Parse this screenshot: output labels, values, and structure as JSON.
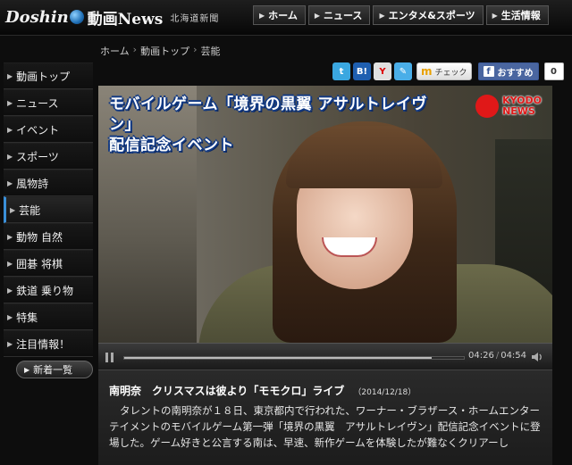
{
  "header": {
    "logo_main": "Doshin",
    "logo_news": "動画News",
    "logo_paper": "北海道新聞",
    "nav": [
      {
        "label": "ホーム"
      },
      {
        "label": "ニュース"
      },
      {
        "label": "エンタメ&スポーツ"
      },
      {
        "label": "生活情報"
      }
    ]
  },
  "breadcrumb": [
    "ホーム",
    "動画トップ",
    "芸能"
  ],
  "sidebar": {
    "items": [
      {
        "label": "動画トップ"
      },
      {
        "label": "ニュース"
      },
      {
        "label": "イベント"
      },
      {
        "label": "スポーツ"
      },
      {
        "label": "風物詩"
      },
      {
        "label": "芸能"
      },
      {
        "label": "動物 自然"
      },
      {
        "label": "囲碁 将棋"
      },
      {
        "label": "鉄道 乗り物"
      },
      {
        "label": "特集"
      },
      {
        "label": "注目情報！"
      }
    ],
    "active_index": 5,
    "new_list_label": "新着一覧"
  },
  "social": {
    "mixi_label": "チェック",
    "fb_label": "おすすめ",
    "fb_count": "0"
  },
  "video": {
    "caption_line1": "モバイルゲーム「境界の黒翼 アサルトレイヴン」",
    "caption_line2": "配信記念イベント",
    "news_logo_line1": "KYODO",
    "news_logo_line2": "NEWS",
    "current_time": "04:26",
    "duration": "04:54",
    "progress": 0.905
  },
  "article": {
    "title": "南明奈　クリスマスは彼より「モモクロ」ライブ",
    "date": "（2014/12/18）",
    "body": "タレントの南明奈が１８日、東京都内で行われた、ワーナー・ブラザース・ホームエンターテイメントのモバイルゲーム第一弾「境界の黒翼　アサルトレイヴン」配信記念イベントに登場した。ゲーム好きと公言する南は、早速、新作ゲームを体験したが難なくクリアーし"
  },
  "colors": {
    "accent": "#3a8fd8",
    "caption_outline": "#123a84",
    "kyodo_red": "#e01818"
  }
}
